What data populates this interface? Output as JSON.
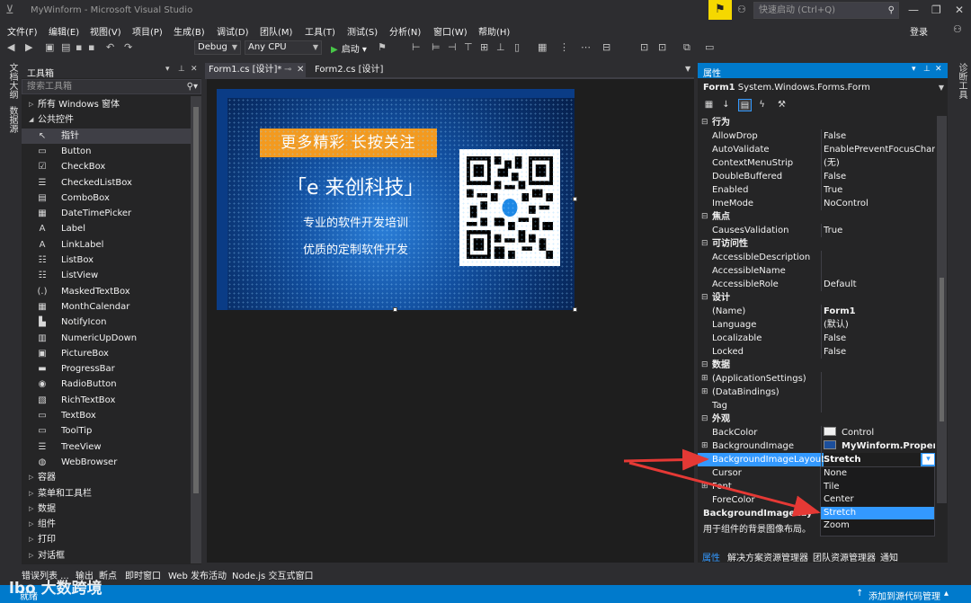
{
  "window": {
    "title": "MyWinform - Microsoft Visual Studio",
    "quick_launch_placeholder": "快速启动 (Ctrl+Q)",
    "login": "登录"
  },
  "menu": [
    "文件(F)",
    "编辑(E)",
    "视图(V)",
    "项目(P)",
    "生成(B)",
    "调试(D)",
    "团队(M)",
    "工具(T)",
    "测试(S)",
    "分析(N)",
    "窗口(W)",
    "帮助(H)"
  ],
  "toolbar": {
    "config": "Debug",
    "platform": "Any CPU",
    "run_label": "启动"
  },
  "left_vtabs": [
    "文档大纲",
    "数据源"
  ],
  "right_vtabs": [
    "诊断工具"
  ],
  "toolbox": {
    "title": "工具箱",
    "search_placeholder": "搜索工具箱",
    "groups_top": [
      "所有 Windows 窗体",
      "公共控件"
    ],
    "items": [
      {
        "label": "指针",
        "icon": "↖"
      },
      {
        "label": "Button",
        "icon": "▭"
      },
      {
        "label": "CheckBox",
        "icon": "☑"
      },
      {
        "label": "CheckedListBox",
        "icon": "☰"
      },
      {
        "label": "ComboBox",
        "icon": "▤"
      },
      {
        "label": "DateTimePicker",
        "icon": "▦"
      },
      {
        "label": "Label",
        "icon": "A"
      },
      {
        "label": "LinkLabel",
        "icon": "A"
      },
      {
        "label": "ListBox",
        "icon": "☷"
      },
      {
        "label": "ListView",
        "icon": "☷"
      },
      {
        "label": "MaskedTextBox",
        "icon": "(.)"
      },
      {
        "label": "MonthCalendar",
        "icon": "▦"
      },
      {
        "label": "NotifyIcon",
        "icon": "▙"
      },
      {
        "label": "NumericUpDown",
        "icon": "▥"
      },
      {
        "label": "PictureBox",
        "icon": "▣"
      },
      {
        "label": "ProgressBar",
        "icon": "▬"
      },
      {
        "label": "RadioButton",
        "icon": "◉"
      },
      {
        "label": "RichTextBox",
        "icon": "▧"
      },
      {
        "label": "TextBox",
        "icon": "▭"
      },
      {
        "label": "ToolTip",
        "icon": "▭"
      },
      {
        "label": "TreeView",
        "icon": "☰"
      },
      {
        "label": "WebBrowser",
        "icon": "◍"
      }
    ],
    "groups_bottom": [
      "容器",
      "菜单和工具栏",
      "数据",
      "组件",
      "打印",
      "对话框"
    ]
  },
  "doc_tabs": [
    {
      "label": "Form1.cs [设计]*",
      "active": true
    },
    {
      "label": "Form2.cs [设计]",
      "active": false
    }
  ],
  "form_image": {
    "banner": "更多精彩  长按关注",
    "brand": "「e 来创科技」",
    "slogan1": "专业的软件开发培训",
    "slogan2": "优质的定制软件开发"
  },
  "properties": {
    "title": "属性",
    "object_name": "Form1",
    "object_type": "System.Windows.Forms.Form",
    "rows": [
      {
        "type": "cat",
        "name": "行为"
      },
      {
        "name": "AllowDrop",
        "value": "False"
      },
      {
        "name": "AutoValidate",
        "value": "EnablePreventFocusChange"
      },
      {
        "name": "ContextMenuStrip",
        "value": "(无)"
      },
      {
        "name": "DoubleBuffered",
        "value": "False"
      },
      {
        "name": "Enabled",
        "value": "True"
      },
      {
        "name": "ImeMode",
        "value": "NoControl"
      },
      {
        "type": "cat",
        "name": "焦点"
      },
      {
        "name": "CausesValidation",
        "value": "True"
      },
      {
        "type": "cat",
        "name": "可访问性"
      },
      {
        "name": "AccessibleDescription",
        "value": ""
      },
      {
        "name": "AccessibleName",
        "value": ""
      },
      {
        "name": "AccessibleRole",
        "value": "Default"
      },
      {
        "type": "cat",
        "name": "设计"
      },
      {
        "name": "(Name)",
        "value": "Form1",
        "bold": true
      },
      {
        "name": "Language",
        "value": "(默认)"
      },
      {
        "name": "Localizable",
        "value": "False"
      },
      {
        "name": "Locked",
        "value": "False"
      },
      {
        "type": "cat",
        "name": "数据"
      },
      {
        "name": "(ApplicationSettings)",
        "value": "",
        "expand": true
      },
      {
        "name": "(DataBindings)",
        "value": "",
        "expand": true
      },
      {
        "name": "Tag",
        "value": ""
      },
      {
        "type": "cat",
        "name": "外观"
      },
      {
        "name": "BackColor",
        "value": "Control",
        "swatch": "#f0f0f0"
      },
      {
        "name": "BackgroundImage",
        "value": "MyWinform.Properties",
        "expand": true,
        "bold": true,
        "imgicon": true
      },
      {
        "name": "BackgroundImageLayout",
        "value": "Stretch",
        "selected": true
      },
      {
        "name": "Cursor",
        "value": ""
      },
      {
        "name": "Font",
        "value": "",
        "expand": true
      },
      {
        "name": "ForeColor",
        "value": ""
      }
    ],
    "dropdown_options": [
      "None",
      "Tile",
      "Center",
      "Stretch",
      "Zoom"
    ],
    "dropdown_selected": "Stretch",
    "description_title": "BackgroundImageLayout",
    "description_text": "用于组件的背景图像布局。",
    "bottom_tabs": [
      "属性",
      "解决方案资源管理器",
      "团队资源管理器",
      "通知"
    ]
  },
  "bottom_tabs": [
    "错误列表 ...",
    "输出",
    "断点",
    "即时窗口",
    "Web 发布活动",
    "Node.js 交互式窗口"
  ],
  "status": {
    "left": "就绪",
    "right": "添加到源代码管理"
  },
  "watermark": "大数跨境"
}
